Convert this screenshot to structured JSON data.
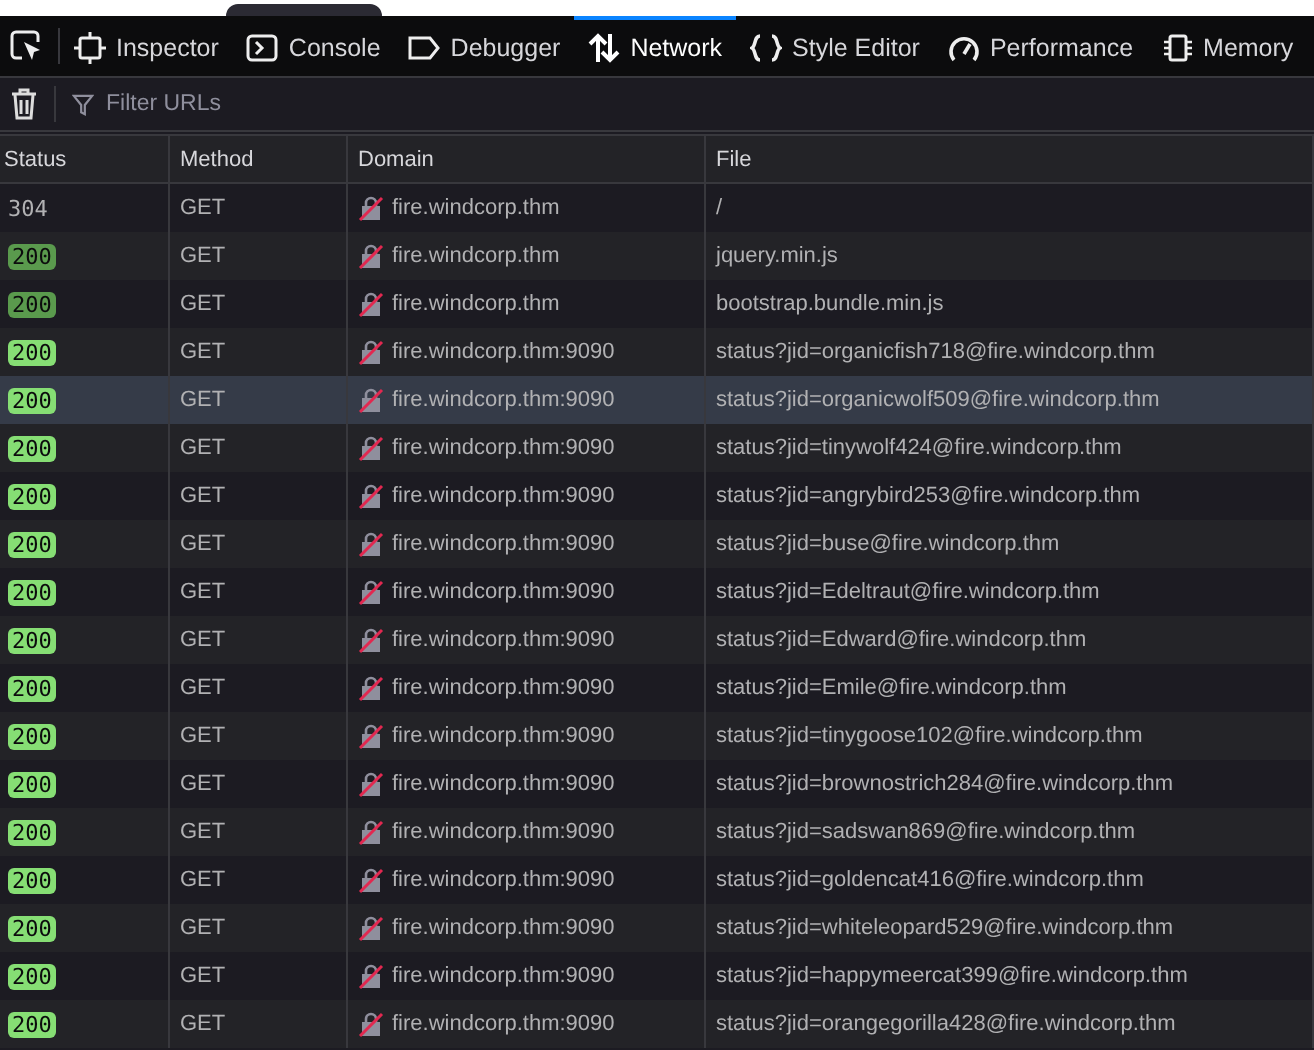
{
  "tabs": [
    {
      "label": "Inspector",
      "selected": false
    },
    {
      "label": "Console",
      "selected": false
    },
    {
      "label": "Debugger",
      "selected": false
    },
    {
      "label": "Network",
      "selected": true
    },
    {
      "label": "Style Editor",
      "selected": false
    },
    {
      "label": "Performance",
      "selected": false
    },
    {
      "label": "Memory",
      "selected": false
    }
  ],
  "filter": {
    "placeholder": "Filter URLs"
  },
  "table": {
    "columns": [
      "Status",
      "Method",
      "Domain",
      "File"
    ],
    "rows": [
      {
        "status": "304",
        "kind": "plain",
        "method": "GET",
        "domain": "fire.windcorp.thm",
        "file": "/",
        "selected": false
      },
      {
        "status": "200",
        "kind": "cached",
        "method": "GET",
        "domain": "fire.windcorp.thm",
        "file": "jquery.min.js",
        "selected": false
      },
      {
        "status": "200",
        "kind": "cached",
        "method": "GET",
        "domain": "fire.windcorp.thm",
        "file": "bootstrap.bundle.min.js",
        "selected": false
      },
      {
        "status": "200",
        "kind": "ok",
        "method": "GET",
        "domain": "fire.windcorp.thm:9090",
        "file": "status?jid=organicfish718@fire.windcorp.thm",
        "selected": false
      },
      {
        "status": "200",
        "kind": "ok",
        "method": "GET",
        "domain": "fire.windcorp.thm:9090",
        "file": "status?jid=organicwolf509@fire.windcorp.thm",
        "selected": true
      },
      {
        "status": "200",
        "kind": "ok",
        "method": "GET",
        "domain": "fire.windcorp.thm:9090",
        "file": "status?jid=tinywolf424@fire.windcorp.thm",
        "selected": false
      },
      {
        "status": "200",
        "kind": "ok",
        "method": "GET",
        "domain": "fire.windcorp.thm:9090",
        "file": "status?jid=angrybird253@fire.windcorp.thm",
        "selected": false
      },
      {
        "status": "200",
        "kind": "ok",
        "method": "GET",
        "domain": "fire.windcorp.thm:9090",
        "file": "status?jid=buse@fire.windcorp.thm",
        "selected": false
      },
      {
        "status": "200",
        "kind": "ok",
        "method": "GET",
        "domain": "fire.windcorp.thm:9090",
        "file": "status?jid=Edeltraut@fire.windcorp.thm",
        "selected": false
      },
      {
        "status": "200",
        "kind": "ok",
        "method": "GET",
        "domain": "fire.windcorp.thm:9090",
        "file": "status?jid=Edward@fire.windcorp.thm",
        "selected": false
      },
      {
        "status": "200",
        "kind": "ok",
        "method": "GET",
        "domain": "fire.windcorp.thm:9090",
        "file": "status?jid=Emile@fire.windcorp.thm",
        "selected": false
      },
      {
        "status": "200",
        "kind": "ok",
        "method": "GET",
        "domain": "fire.windcorp.thm:9090",
        "file": "status?jid=tinygoose102@fire.windcorp.thm",
        "selected": false
      },
      {
        "status": "200",
        "kind": "ok",
        "method": "GET",
        "domain": "fire.windcorp.thm:9090",
        "file": "status?jid=brownostrich284@fire.windcorp.thm",
        "selected": false
      },
      {
        "status": "200",
        "kind": "ok",
        "method": "GET",
        "domain": "fire.windcorp.thm:9090",
        "file": "status?jid=sadswan869@fire.windcorp.thm",
        "selected": false
      },
      {
        "status": "200",
        "kind": "ok",
        "method": "GET",
        "domain": "fire.windcorp.thm:9090",
        "file": "status?jid=goldencat416@fire.windcorp.thm",
        "selected": false
      },
      {
        "status": "200",
        "kind": "ok",
        "method": "GET",
        "domain": "fire.windcorp.thm:9090",
        "file": "status?jid=whiteleopard529@fire.windcorp.thm",
        "selected": false
      },
      {
        "status": "200",
        "kind": "ok",
        "method": "GET",
        "domain": "fire.windcorp.thm:9090",
        "file": "status?jid=happymeercat399@fire.windcorp.thm",
        "selected": false
      },
      {
        "status": "200",
        "kind": "ok",
        "method": "GET",
        "domain": "fire.windcorp.thm:9090",
        "file": "status?jid=orangegorilla428@fire.windcorp.thm",
        "selected": false
      }
    ]
  }
}
